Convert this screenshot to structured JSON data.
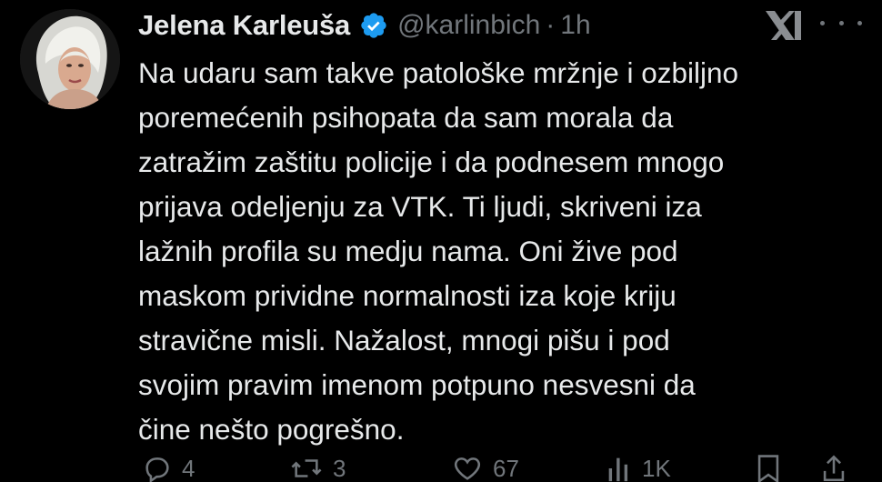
{
  "author": {
    "display_name": "Jelena Karleuša",
    "handle": "@karlinbich",
    "separator": "·",
    "timestamp": "1h",
    "verified": true
  },
  "tweet": {
    "lines": [
      "Na udaru sam takve patološke mržnje i ozbiljno",
      "poremećenih psihopata da sam morala da",
      "zatražim zaštitu policije i da podnesem mnogo",
      "prijava odeljenju za VTK. Ti ljudi, skriveni iza",
      "lažnih profila su medju nama. Oni žive pod",
      "maskom prividne normalnosti iza koje kriju",
      "stravične misli. Nažalost, mnogi pišu i pod",
      "svojim pravim imenom potpuno nesvesni da",
      "čine nešto pogrešno."
    ]
  },
  "actions": {
    "replies": "4",
    "reposts": "3",
    "likes": "67",
    "views": "1K"
  },
  "icons": {
    "verified": "verified-badge-icon",
    "logo": "x-logo-icon",
    "more": "more-dots-icon",
    "reply": "reply-icon",
    "repost": "repost-icon",
    "like": "heart-icon",
    "views": "views-icon",
    "bookmark": "bookmark-icon",
    "share": "share-icon"
  },
  "colors": {
    "background": "#000000",
    "text": "#e7e9ea",
    "secondary": "#71767b",
    "verified": "#1d9bf0"
  }
}
